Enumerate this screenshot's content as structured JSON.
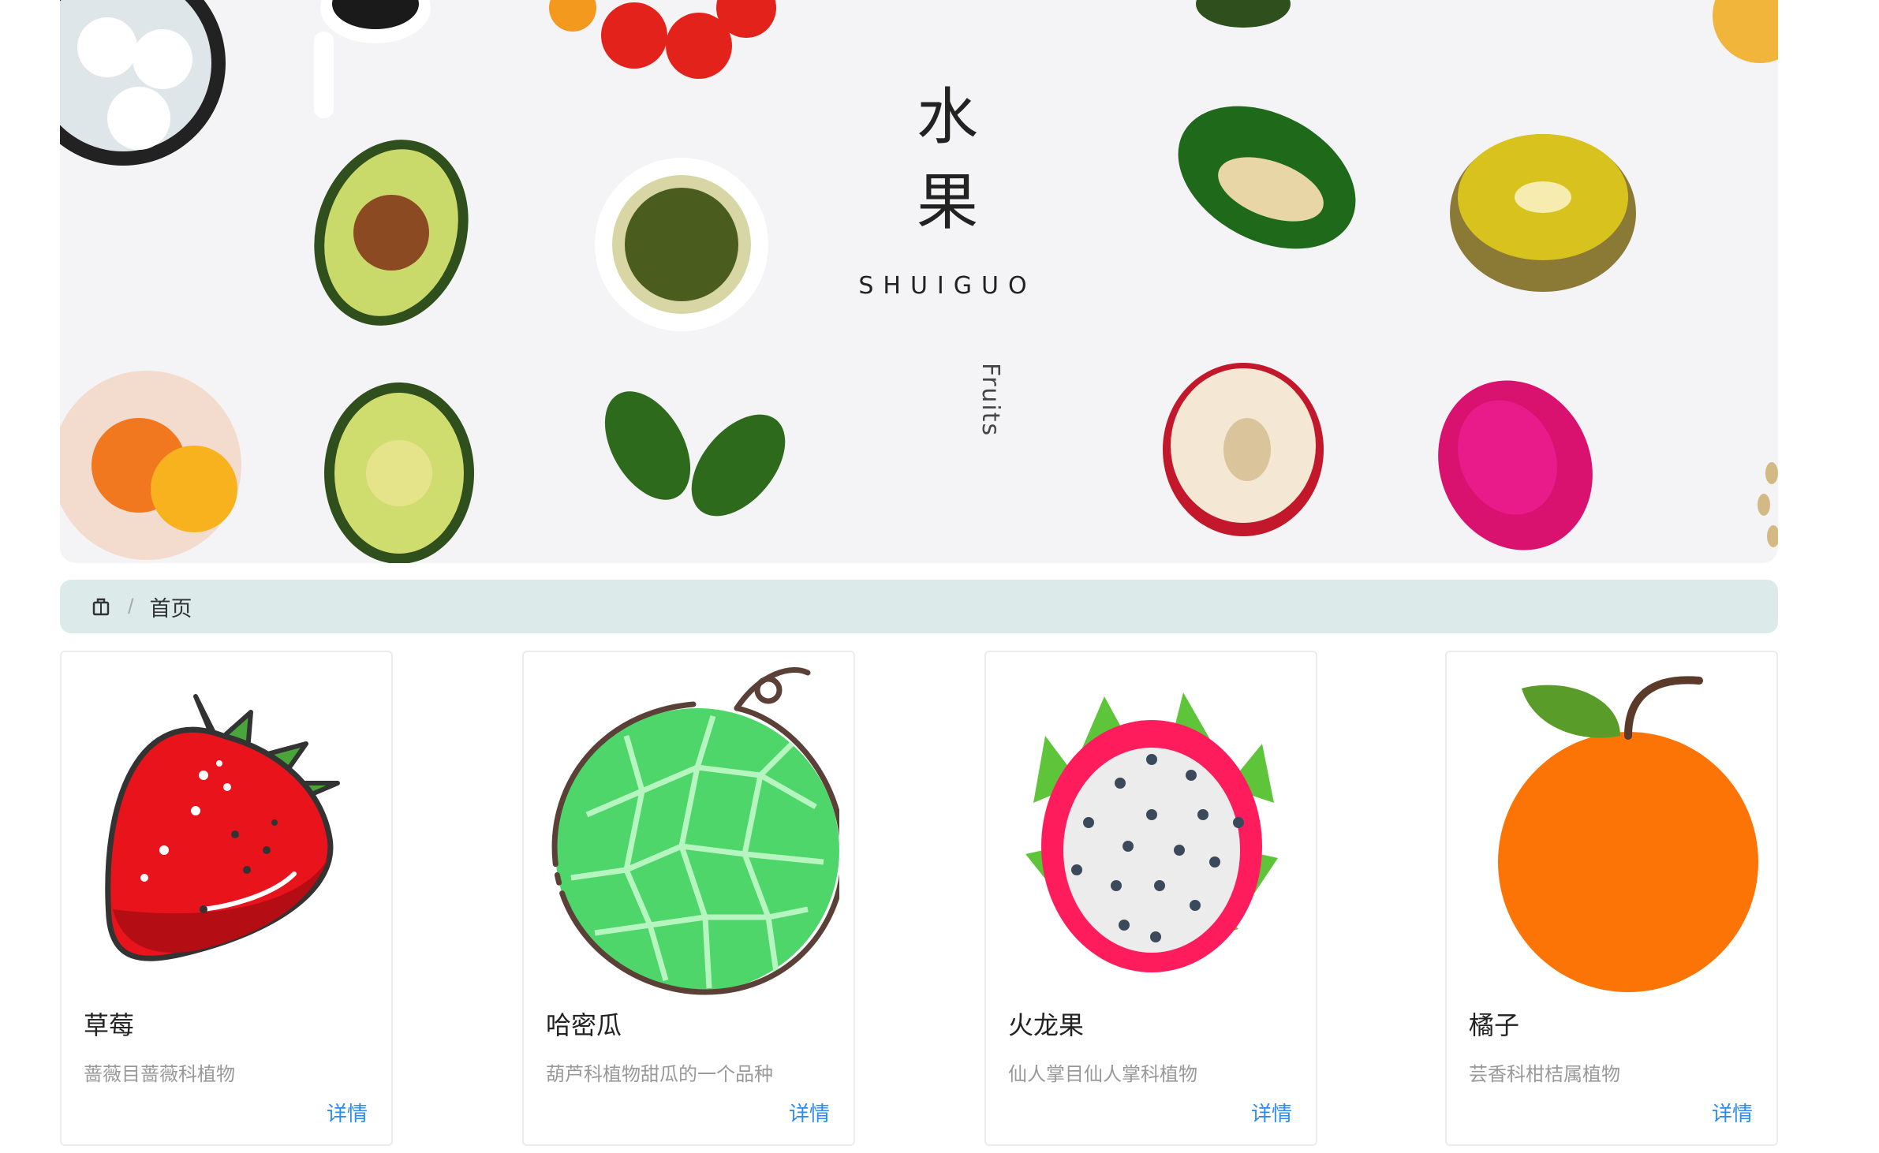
{
  "banner": {
    "title_line1": "水",
    "title_line2": "果",
    "subtitle": "SHUIGUO",
    "vertical_text": "Fruits"
  },
  "breadcrumb": {
    "icon": "home-icon",
    "items": [
      "首页"
    ]
  },
  "cards": [
    {
      "name": "草莓",
      "desc": "蔷薇目蔷薇科植物",
      "action": "详情",
      "icon": "strawberry-icon"
    },
    {
      "name": "哈密瓜",
      "desc": "葫芦科植物甜瓜的一个品种",
      "action": "详情",
      "icon": "melon-icon"
    },
    {
      "name": "火龙果",
      "desc": "仙人掌目仙人掌科植物",
      "action": "详情",
      "icon": "dragon-fruit-icon"
    },
    {
      "name": "橘子",
      "desc": "芸香科柑桔属植物",
      "action": "详情",
      "icon": "orange-icon"
    }
  ],
  "colors": {
    "breadcrumb_bg": "#dcebea",
    "link": "#2d8cf0",
    "strawberry": "#e8131b",
    "melon": "#4fd66a",
    "dragon_fruit": "#ff1c5c",
    "orange": "#fb7405"
  }
}
